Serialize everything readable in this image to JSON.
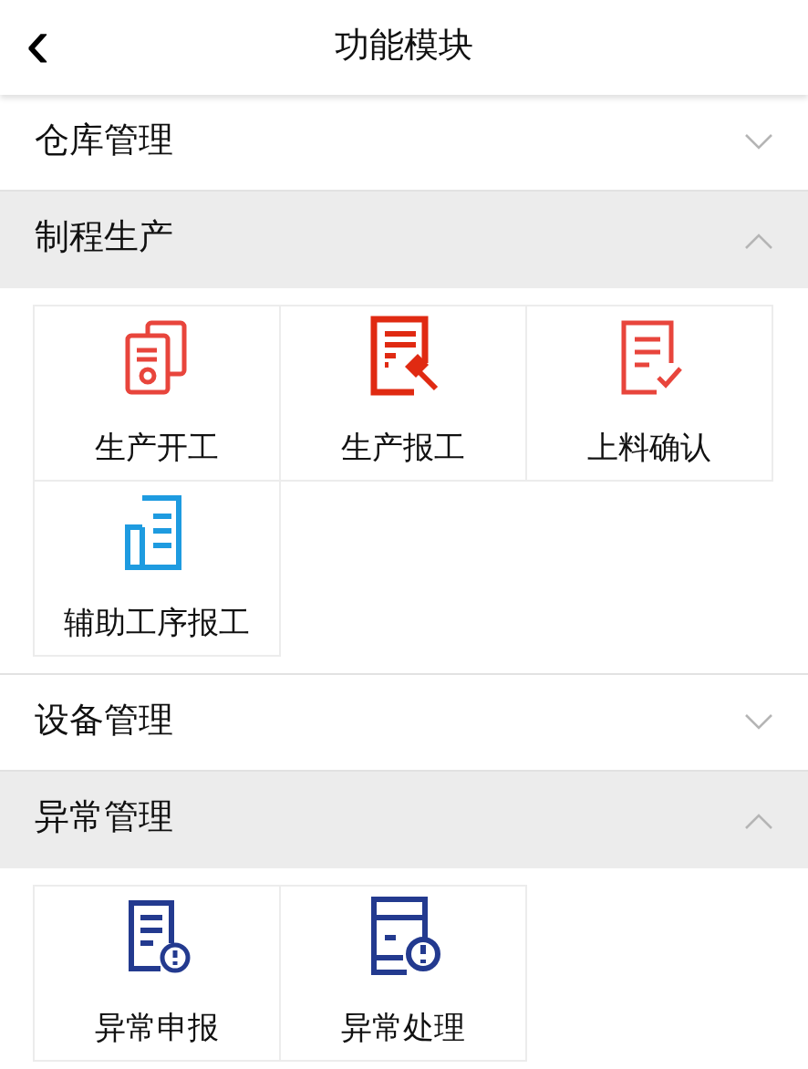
{
  "header": {
    "back_icon": "‹",
    "title": "功能模块"
  },
  "sections": [
    {
      "title": "仓库管理",
      "expanded": false
    },
    {
      "title": "制程生产",
      "expanded": true,
      "items": [
        {
          "label": "生产开工",
          "kind": "doc-stack",
          "color": "#e8453c"
        },
        {
          "label": "生产报工",
          "kind": "doc-gavel",
          "color": "#e02a12"
        },
        {
          "label": "上料确认",
          "kind": "doc-check",
          "color": "#e8453c"
        },
        {
          "label": "辅助工序报工",
          "kind": "doc-scroll",
          "color": "#1e9be0"
        }
      ]
    },
    {
      "title": "设备管理",
      "expanded": false
    },
    {
      "title": "异常管理",
      "expanded": true,
      "items": [
        {
          "label": "异常申报",
          "kind": "doc-alert",
          "color": "#233a8f"
        },
        {
          "label": "异常处理",
          "kind": "panel-alert",
          "color": "#233a8f"
        }
      ]
    }
  ]
}
